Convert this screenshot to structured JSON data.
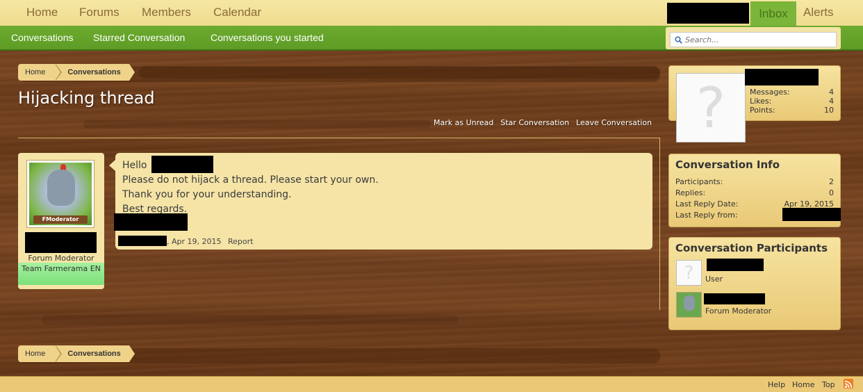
{
  "nav": {
    "tabs": [
      "Home",
      "Forums",
      "Members",
      "Calendar"
    ],
    "inbox": "Inbox",
    "alerts": "Alerts"
  },
  "subnav": {
    "links": [
      "Conversations",
      "Starred Conversation",
      "Conversations you started"
    ],
    "search_placeholder": "Search..."
  },
  "breadcrumb": [
    "Home",
    "Conversations"
  ],
  "page": {
    "title": "Hijacking thread",
    "actions": [
      "Mark as Unread",
      "Star Conversation",
      "Leave Conversation"
    ]
  },
  "message": {
    "author_role": "Forum Moderator",
    "author_team": "Team Farmerama EN",
    "avatar_badge": "FModerator",
    "greeting": "Hello",
    "lines": [
      "Please do not hijack a thread. Please start your own.",
      "Thank you for your understanding.",
      "Best regards."
    ],
    "date": ", Apr 19, 2015",
    "report": "Report"
  },
  "profile": {
    "messages_label": "Messages:",
    "messages": "4",
    "likes_label": "Likes:",
    "likes": "4",
    "points_label": "Points:",
    "points": "10"
  },
  "conversation_info": {
    "heading": "Conversation Info",
    "participants_label": "Participants:",
    "participants": "2",
    "replies_label": "Replies:",
    "replies": "0",
    "last_reply_date_label": "Last Reply Date:",
    "last_reply_date": "Apr 19, 2015",
    "last_reply_from_label": "Last Reply from:"
  },
  "participants": {
    "heading": "Conversation Participants",
    "items": [
      {
        "role": "User"
      },
      {
        "role": "Forum Moderator"
      }
    ]
  },
  "footer": {
    "links": [
      "Help",
      "Home",
      "Top"
    ]
  },
  "colors": {
    "nav_green": "#6cab2e",
    "inbox_green": "#7bb53a",
    "panel": "#f5e4a6"
  }
}
